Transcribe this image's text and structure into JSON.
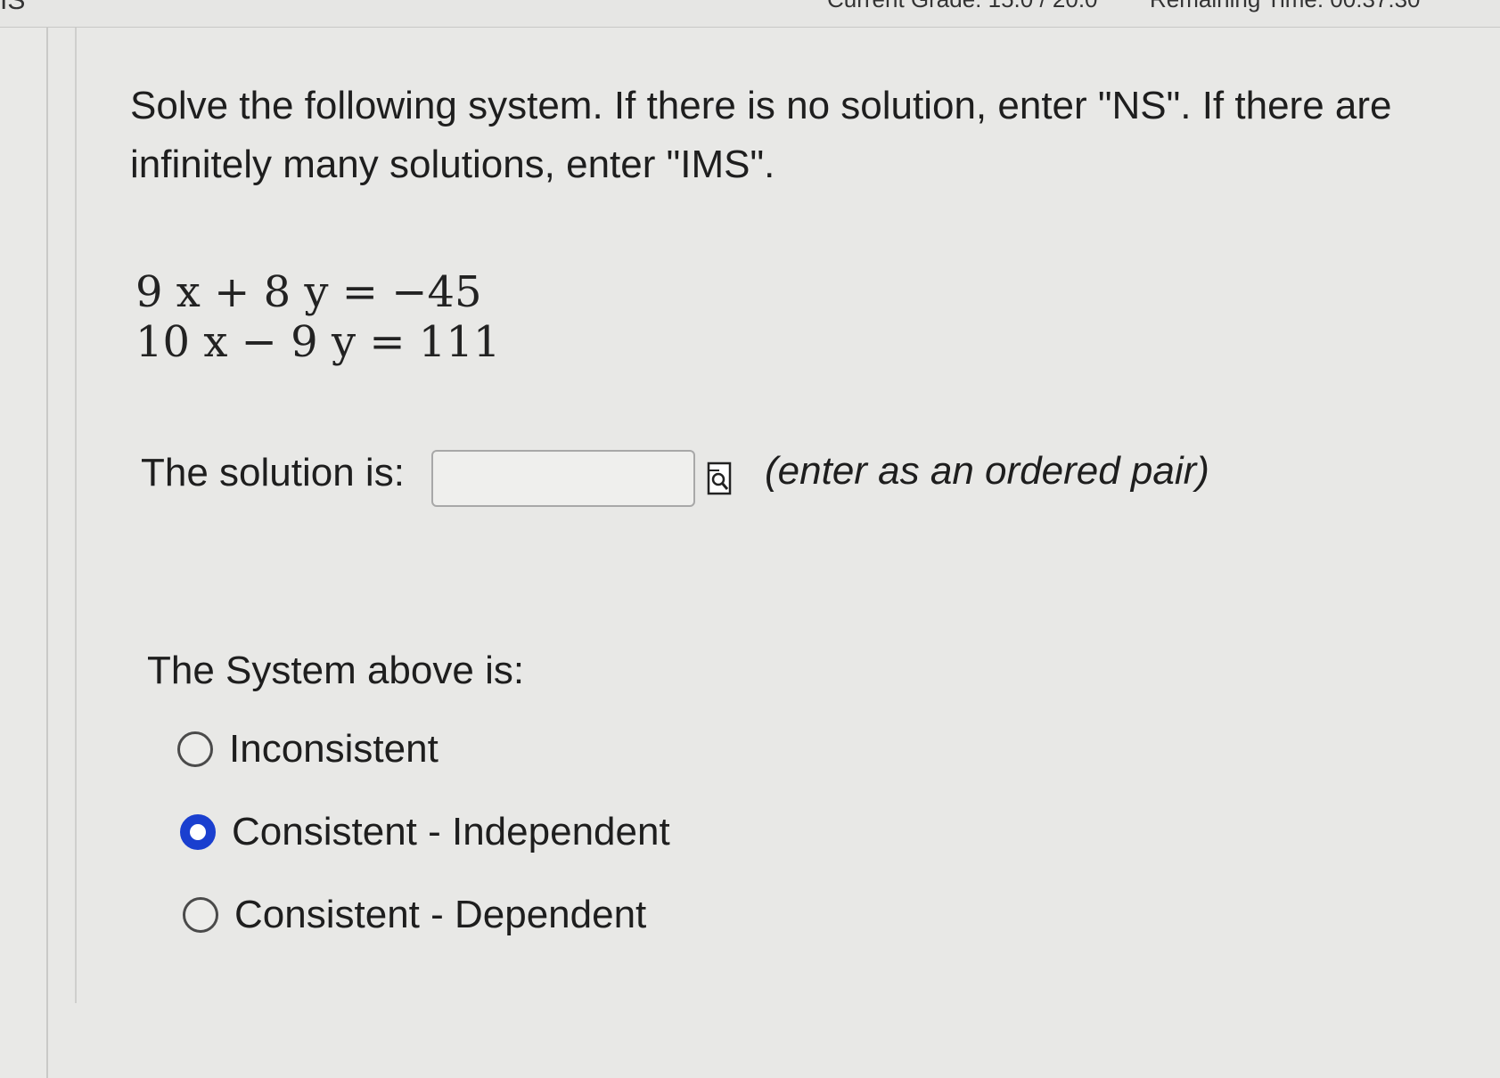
{
  "topbar": {
    "left_text": "IS",
    "grade_text": "Current Grade: 15.0 / 20.0",
    "time_text": "Remaining Time: 00:37:30"
  },
  "question": {
    "prompt": "Solve the following system. If there is no solution, enter \"NS\". If there are infinitely many solutions, enter \"IMS\".",
    "equations": [
      "9 x + 8 y = −45",
      "10 x − 9 y = 111"
    ]
  },
  "solution": {
    "label": "The solution is:",
    "input_value": "",
    "hint": "(enter as an ordered pair)",
    "preview_icon": "preview-document-icon"
  },
  "system": {
    "label": "The System above is:",
    "selected_index": 1,
    "options": [
      {
        "label": "Inconsistent",
        "selected": false
      },
      {
        "label": "Consistent - Independent",
        "selected": true
      },
      {
        "label": "Consistent - Dependent",
        "selected": false
      }
    ]
  },
  "colors": {
    "background": "#e8e8e6",
    "radio_selected": "#1a3fcf",
    "text": "#1e1e1e"
  }
}
